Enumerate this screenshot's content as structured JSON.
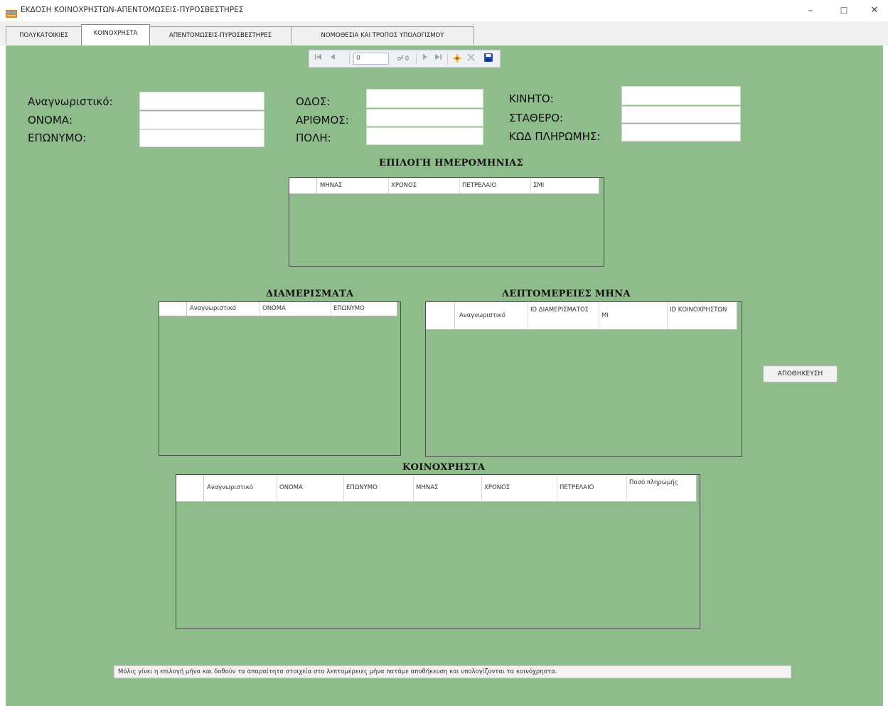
{
  "window": {
    "title": "ΕΚΔΟΣΗ ΚΟΙΝΟΧΡΗΣΤΩΝ-ΑΠΕΝΤΟΜΩΣΕΙΣ-ΠΥΡΟΣΒΕΣΤΗΡΕΣ",
    "minimize": "–",
    "maximize": "☐",
    "close": "✕"
  },
  "tabs": [
    {
      "label": "ΠΟΛΥΚΑΤΟΙΚΙΕΣ",
      "active": false
    },
    {
      "label": "ΚΟΙΝΟΧΡΗΣΤΑ",
      "active": true
    },
    {
      "label": "ΑΠΕΝΤΟΜΩΣΕΙΣ-ΠΥΡΟΣΒΕΣΤΗΡΕΣ",
      "active": false
    },
    {
      "label": "ΝΟΜΟΘΕΣΙΑ ΚΑΙ ΤΡΟΠΟΣ ΥΠΟΛΟΓΙΣΜΟΥ",
      "active": false
    }
  ],
  "navigator": {
    "position": "0",
    "count_label": "of 0",
    "icons": [
      "move-first-icon",
      "move-previous-icon",
      "move-next-icon",
      "move-last-icon",
      "add-new-icon",
      "delete-icon",
      "save-icon"
    ]
  },
  "form": {
    "id_label": "Αναγνωριστικό:",
    "name_label": "ΟΝΟΜΑ:",
    "surname_label": "ΕΠΩΝΥΜΟ:",
    "street_label": "ΟΔΟΣ:",
    "number_label": "ΑΡΙΘΜΟΣ:",
    "city_label": "ΠΟΛΗ:",
    "mobile_label": "ΚΙΝΗΤΟ:",
    "landline_label": "ΣΤΑΘΕΡΟ:",
    "paycode_label": "ΚΩΔ ΠΛΗΡΩΜΗΣ:",
    "values": {
      "id": "",
      "name": "",
      "surname": "",
      "street": "",
      "number": "",
      "city": "",
      "mobile": "",
      "landline": "",
      "paycode": ""
    }
  },
  "date_grid": {
    "title": "ΕΠΙΛΟΓΗ ΗΜΕΡΟΜΗΝΙΑΣ",
    "columns": [
      "ΜΗΝΑΣ",
      "ΧΡΟΝΟΣ",
      "ΠΕΤΡΕΛΑΙΟ",
      "ΣΜΙ"
    ]
  },
  "apartments_grid": {
    "title": "ΔΙΑΜΕΡΙΣΜΑΤΑ",
    "columns": [
      "Αναγνωριστικό",
      "ΟΝΟΜΑ",
      "ΕΠΩΝΥΜΟ"
    ]
  },
  "month_details_grid": {
    "title": "ΛΕΠΤΟΜΕΡΕΙΕΣ ΜΗΝΑ",
    "columns": [
      "Αναγνωριστικό",
      "ID ΔΙΑΜΕΡΙΣΜΑΤΟΣ",
      "ΜΙ",
      "ID ΚΟΙΝΟΧΡΗΣΤΩΝ"
    ]
  },
  "common_charges_grid": {
    "title": "ΚΟΙΝΟΧΡΗΣΤΑ",
    "columns": [
      "Αναγνωριστικό",
      "ΟΝΟΜΑ",
      "ΕΠΩΝΥΜΟ",
      "ΜΗΝΑΣ",
      "ΧΡΟΝΟΣ",
      "ΠΕΤΡΕΛΑΙΟ",
      "Ποσό πληρωμής"
    ]
  },
  "save_button": "ΑΠΟΘΗΚΕΥΣΗ",
  "info_text": "Μόλις γίνει η επιλογή μήνα και δοθούν τα απαραίτητα στοιχεία στο λεπτομέρειες μήνα πατάμε αποθήκευση και υπολογίζονται τα κοινόχρηστα.",
  "colors": {
    "page_background": "#8fbc8b",
    "grid_header": "#ffffff",
    "navigator_icon_add": "#f0b429",
    "navigator_icon_save": "#1f4fb0"
  }
}
